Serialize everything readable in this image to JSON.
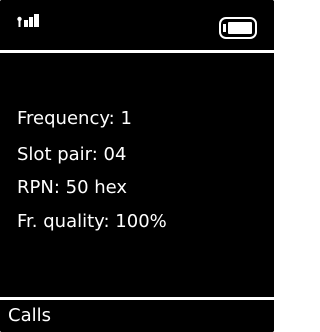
{
  "status": {
    "signal_icon": "signal-bars-icon",
    "battery_icon": "battery-icon"
  },
  "info": {
    "lines": [
      "Frequency: 1",
      "Slot pair: 04",
      "RPN: 50 hex",
      "Fr. quality: 100%"
    ]
  },
  "softkeys": {
    "left_label": "Calls"
  },
  "colors": {
    "background": "#000000",
    "foreground": "#ffffff"
  }
}
